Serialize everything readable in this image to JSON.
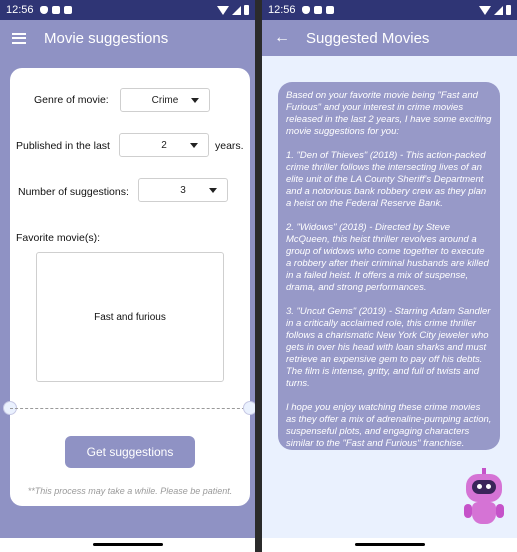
{
  "status": {
    "time": "12:56"
  },
  "left": {
    "appbar": {
      "title": "Movie suggestions"
    },
    "form": {
      "genre_label": "Genre of movie:",
      "genre_value": "Crime",
      "published_label": "Published in the last",
      "published_value": "2",
      "published_suffix": "years.",
      "count_label": "Number of suggestions:",
      "count_value": "3",
      "favorite_label": "Favorite movie(s):",
      "favorite_value": "Fast and furious"
    },
    "button_label": "Get suggestions",
    "note": "**This process may take a while. Please be patient."
  },
  "right": {
    "appbar": {
      "title": "Suggested Movies"
    },
    "paragraphs": [
      "Based on your favorite movie being \"Fast and Furious\" and your interest in crime movies released in the last 2 years, I have some exciting movie suggestions for you:",
      "1. \"Den of Thieves\" (2018) - This action-packed crime thriller follows the intersecting lives of an elite unit of the LA County Sheriff's Department and a notorious bank robbery crew as they plan a heist on the Federal Reserve Bank.",
      "2. \"Widows\" (2018) - Directed by Steve McQueen, this heist thriller revolves around a group of widows who come together to execute a robbery after their criminal husbands are killed in a failed heist. It offers a mix of suspense, drama, and strong performances.",
      "3. \"Uncut Gems\" (2019) - Starring Adam Sandler in a critically acclaimed role, this crime thriller follows a charismatic New York City jeweler who gets in over his head with loan sharks and must retrieve an expensive gem to pay off his debts. The film is intense, gritty, and full of twists and turns.",
      "I hope you enjoy watching these crime movies as they offer a mix of adrenaline-pumping action, suspenseful plots, and engaging characters similar to the \"Fast and Furious\" franchise."
    ]
  },
  "colors": {
    "status_bar": "#2f3575",
    "app_bar": "#8f92c4",
    "bubble": "#9799c8",
    "background_right": "#eaf1fe"
  },
  "icons": [
    "menu-icon",
    "back-arrow-icon",
    "wifi-icon",
    "signal-icon",
    "battery-icon",
    "robot-assistant-icon"
  ]
}
